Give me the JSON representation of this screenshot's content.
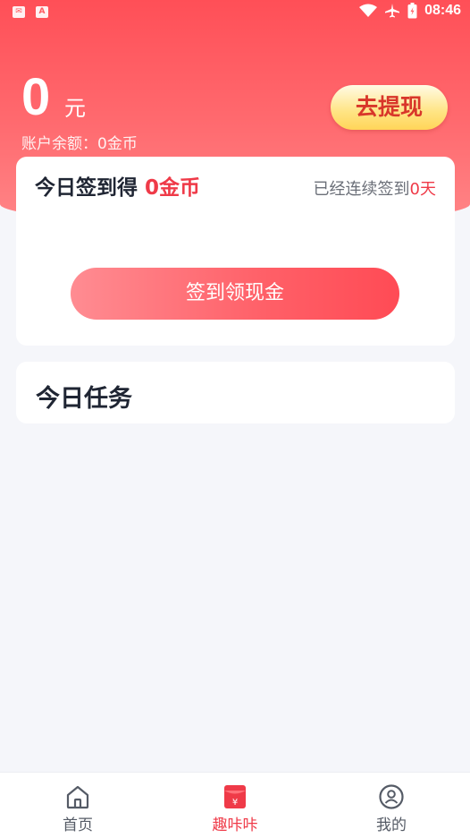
{
  "status_bar": {
    "time": "08:46",
    "left_icons": [
      "mail-icon",
      "font-a-icon"
    ],
    "right_icons": [
      "wifi-icon",
      "airplane-icon",
      "battery-icon"
    ]
  },
  "header": {
    "amount": "0",
    "unit": "元",
    "account_balance": "账户余额：0金币",
    "withdraw_label": "去提现"
  },
  "signin": {
    "title_prefix": "今日签到得",
    "title_amount": "0金币",
    "streak_prefix": "已经连续签到",
    "streak_days": "0天",
    "button_label": "签到领现金"
  },
  "tasks": {
    "title": "今日任务"
  },
  "bottom_nav": {
    "items": [
      {
        "label": "首页",
        "icon": "home-icon",
        "active": false
      },
      {
        "label": "趣咔咔",
        "icon": "red-envelope-icon",
        "active": true
      },
      {
        "label": "我的",
        "icon": "profile-icon",
        "active": false
      }
    ]
  },
  "colors": {
    "header_red": "#ff5a60",
    "accent_red": "#ef3a48",
    "withdraw_gold": "#ffe483",
    "page_bg": "#f5f6fa"
  }
}
